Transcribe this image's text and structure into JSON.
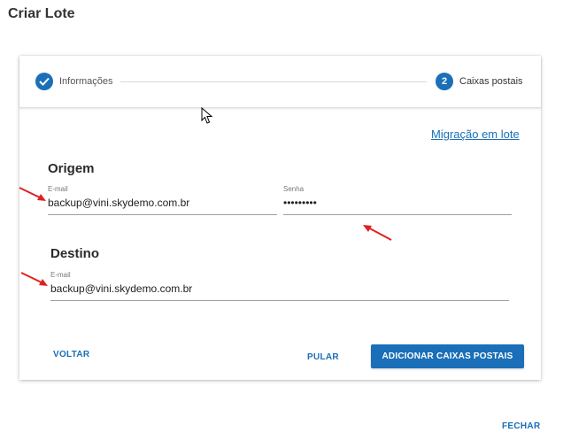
{
  "dialog": {
    "title": "Criar Lote",
    "close_label": "FECHAR"
  },
  "stepper": {
    "steps": [
      {
        "label": "Informações",
        "state": "completed",
        "icon": "check-icon"
      },
      {
        "label": "Caixas postais",
        "number": "2",
        "state": "active"
      }
    ]
  },
  "migration_link": "Migração em lote",
  "origin": {
    "heading": "Origem",
    "email_label": "E-mail",
    "email_value": "backup@vini.skydemo.com.br",
    "password_label": "Senha",
    "password_value": "•••••••••"
  },
  "destination": {
    "heading": "Destino",
    "email_label": "E-mail",
    "email_value": "backup@vini.skydemo.com.br"
  },
  "actions": {
    "back_label": "VOLTAR",
    "skip_label": "PULAR",
    "add_label": "ADICIONAR CAIXAS POSTAIS"
  },
  "colors": {
    "accent": "#1a6fb8",
    "annotation_arrow": "#e02020"
  }
}
